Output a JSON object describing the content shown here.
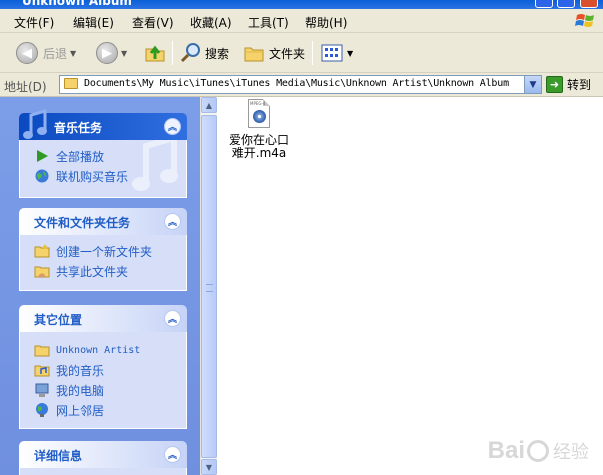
{
  "window": {
    "title": "Unknown Album"
  },
  "menu": [
    "文件(F)",
    "编辑(E)",
    "查看(V)",
    "收藏(A)",
    "工具(T)",
    "帮助(H)"
  ],
  "toolbar": {
    "back": "后退",
    "search": "搜索",
    "folders": "文件夹"
  },
  "address": {
    "label": "地址(D)",
    "path": "Documents\\My Music\\iTunes\\iTunes Media\\Music\\Unknown Artist\\Unknown Album",
    "go": "转到"
  },
  "panels": [
    {
      "title": "音乐任务",
      "items": [
        "全部播放",
        "联机购买音乐"
      ]
    },
    {
      "title": "文件和文件夹任务",
      "items": [
        "创建一个新文件夹",
        "共享此文件夹"
      ]
    },
    {
      "title": "其它位置",
      "items": [
        "Unknown Artist",
        "我的音乐",
        "我的电脑",
        "网上邻居"
      ]
    },
    {
      "title": "详细信息",
      "items": []
    }
  ],
  "files": [
    {
      "line1": "爱你在心口",
      "line2": "难开.m4a",
      "icon_tag": "MPEG-4"
    }
  ],
  "watermark": {
    "text": "Bai",
    "text2": "经验"
  },
  "colors": {
    "task_blue": "#215dc6",
    "pane_bg": "#7c9ee8",
    "xp_toolbar": "#ece9d8"
  }
}
